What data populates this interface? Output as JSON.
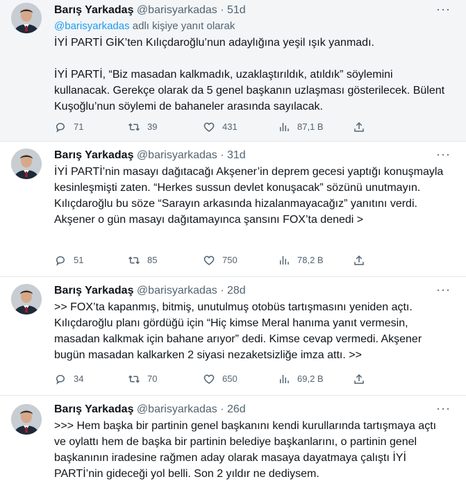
{
  "tweets": [
    {
      "name": "Barış Yarkadaş",
      "handle": "@barisyarkadas",
      "sep": "·",
      "time": "51d",
      "more": "···",
      "reply_mention": "@barisyarkadas",
      "reply_suffix": " adlı kişiye yanıt olarak",
      "text": "İYİ PARTİ GİK’ten Kılıçdaroğlu’nun adaylığına yeşil ışık yanmadı.\n\nİYİ PARTİ, “Biz masadan kalkmadık, uzaklaştırıldık, atıldık” söylemini kullanacak. Gerekçe olarak da 5 genel başkanın uzlaşması gösterilecek. Bülent Kuşoğlu’nun söylemi de bahaneler arasında sayılacak.",
      "replies": "71",
      "retweets": "39",
      "likes": "431",
      "views": "87,1 B"
    },
    {
      "name": "Barış Yarkadaş",
      "handle": "@barisyarkadas",
      "sep": "·",
      "time": "31d",
      "more": "···",
      "text": "İYİ PARTİ’nin masayı dağıtacağı Akşener’in deprem gecesi yaptığı konuşmayla kesinleşmişti zaten. “Herkes sussun devlet konuşacak” sözünü unutmayın. Kılıçdaroğlu bu söze “Sarayın arkasında hizalanmayacağız” yanıtını verdi. Akşener o gün masayı dağıtamayınca şansını FOX’ta denedi >",
      "replies": "51",
      "retweets": "85",
      "likes": "750",
      "views": "78,2 B"
    },
    {
      "name": "Barış Yarkadaş",
      "handle": "@barisyarkadas",
      "sep": "·",
      "time": "28d",
      "more": "···",
      "text": ">> FOX’ta kapanmış, bitmiş, unutulmuş otobüs tartışmasını yeniden açtı. Kılıçdaroğlu planı gördüğü için “Hiç kimse Meral hanıma yanıt vermesin, masadan kalkmak için bahane arıyor” dedi. Kimse cevap vermedi. Akşener bugün masadan kalkarken 2 siyasi nezaketsizliğe imza attı. >>",
      "replies": "34",
      "retweets": "70",
      "likes": "650",
      "views": "69,2 B"
    },
    {
      "name": "Barış Yarkadaş",
      "handle": "@barisyarkadas",
      "sep": "·",
      "time": "26d",
      "more": "···",
      "text": ">>> Hem başka bir partinin genel başkanını kendi kurullarında tartışmaya açtı ve oylattı hem de başka bir partinin belediye başkanlarını, o partinin genel başkanının iradesine rağmen aday olarak masaya dayatmaya çalıştı İYİ PARTİ’nin gideceği yol belli. Son 2 yıldır ne dediysem."
    }
  ],
  "colors": {
    "mention": "#1d9bf0",
    "secondary": "#536471"
  },
  "icons": [
    "reply-icon",
    "retweet-icon",
    "like-icon",
    "views-icon",
    "share-icon"
  ]
}
